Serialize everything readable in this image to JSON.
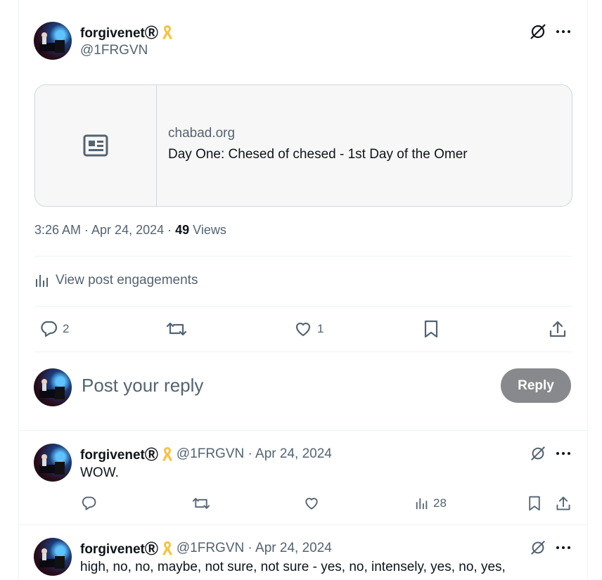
{
  "post": {
    "author_name": "forgivenetⓇ",
    "author_handle": "@1FRGVN",
    "link_card": {
      "domain": "chabad.org",
      "title": "Day One: Chesed of chesed - 1st Day of the Omer"
    },
    "timestamp": "3:26 AM · Apr 24, 2024 · ",
    "views_count": "49",
    "views_label": " Views",
    "engagements_label": "View post engagements",
    "actions": {
      "replies": "2",
      "reposts": "",
      "likes": "1"
    }
  },
  "composer": {
    "placeholder": "Post your reply",
    "reply_label": "Reply"
  },
  "replies": [
    {
      "author_name": "forgivenetⓇ",
      "meta": "@1FRGVN · Apr 24, 2024",
      "text": "WOW.",
      "views": "28"
    },
    {
      "author_name": "forgivenetⓇ",
      "meta": "@1FRGVN · Apr 24, 2024",
      "text": "high, no, no, maybe, not sure, not sure - yes, no, intensely, yes, no, yes,"
    }
  ],
  "colors": {
    "ribbon": "#f6c344",
    "muted": "#536471",
    "reply_button": "#87898c"
  }
}
